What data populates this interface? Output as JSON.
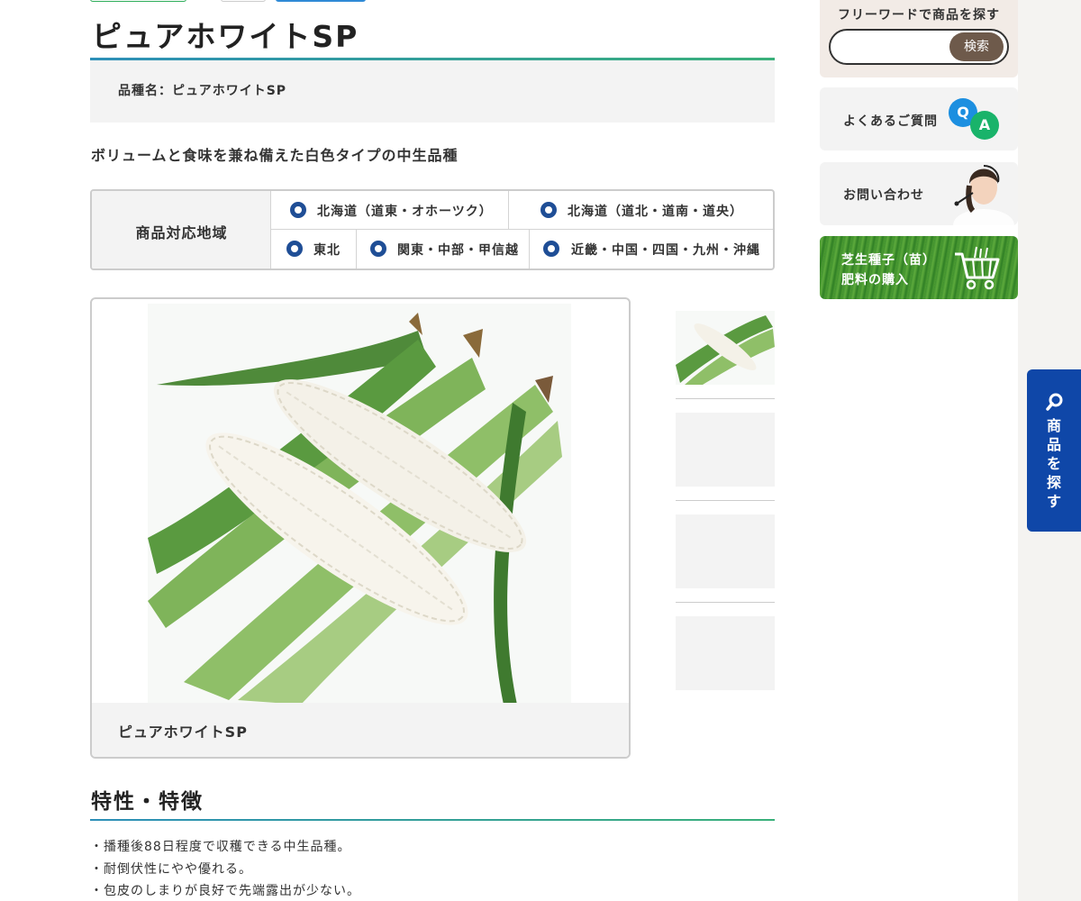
{
  "product": {
    "title": "ピュアホワイトSP",
    "variety_label": "品種名：ピュアホワイトSP",
    "catchphrase": "ボリュームと食味を兼ね備えた白色タイプの中生品種"
  },
  "regions": {
    "header": "商品対応地域",
    "items": [
      "北海道（道東・オホーツク）",
      "北海道（道北・道南・道央）",
      "東北",
      "関東・中部・甲信越",
      "近畿・中国・四国・九州・沖縄"
    ]
  },
  "gallery": {
    "caption": "ピュアホワイトSP",
    "main_image": "white-corn-photo",
    "thumbnail_count": 4
  },
  "features": {
    "heading": "特性・特徴",
    "items": [
      "・播種後88日程度で収穫できる中生品種。",
      "・耐倒伏性にやや優れる。",
      "・包皮のしまりが良好で先端露出が少ない。"
    ]
  },
  "sidebar": {
    "search_label": "フリーワードで商品を探す",
    "search_placeholder": "",
    "search_button": "検索",
    "faq_label": "よくあるご質問",
    "faq_q": "Q",
    "faq_a": "A",
    "contact_label": "お問い合わせ",
    "lawn_label_1": "芝生種子（苗）",
    "lawn_label_2": "肥料の購入",
    "float_tab_label": "商品を探す"
  },
  "colors": {
    "accent_blue": "#0f47a8",
    "accent_green": "#3ab07a",
    "radio": "#1f4e96",
    "search_button": "#6e5a4b"
  }
}
